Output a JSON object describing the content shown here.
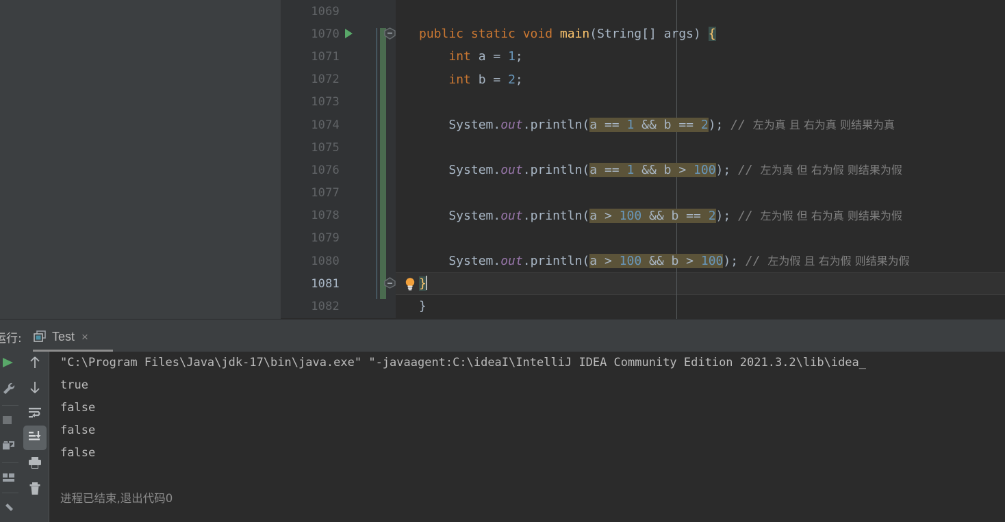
{
  "editor": {
    "lines": [
      {
        "number": "1069",
        "tokens": []
      },
      {
        "number": "1070",
        "indent": 1,
        "runnable": true,
        "fold_start": true,
        "tokens": [
          {
            "t": "public ",
            "c": "kw"
          },
          {
            "t": "static ",
            "c": "kw"
          },
          {
            "t": "void ",
            "c": "kw"
          },
          {
            "t": "main",
            "c": "mth"
          },
          {
            "t": "(",
            "c": "pl"
          },
          {
            "t": "String",
            "c": "cls"
          },
          {
            "t": "[] args) ",
            "c": "pl"
          },
          {
            "t": "{",
            "c": "brace-hl"
          }
        ]
      },
      {
        "number": "1071",
        "tokens": [
          {
            "t": "    ",
            "c": "pl"
          },
          {
            "t": "int ",
            "c": "kw"
          },
          {
            "t": "a = ",
            "c": "pl"
          },
          {
            "t": "1",
            "c": "num"
          },
          {
            "t": ";",
            "c": "pl"
          }
        ]
      },
      {
        "number": "1072",
        "tokens": [
          {
            "t": "    ",
            "c": "pl"
          },
          {
            "t": "int ",
            "c": "kw"
          },
          {
            "t": "b = ",
            "c": "pl"
          },
          {
            "t": "2",
            "c": "num"
          },
          {
            "t": ";",
            "c": "pl"
          }
        ]
      },
      {
        "number": "1073",
        "tokens": []
      },
      {
        "number": "1074",
        "tokens": [
          {
            "t": "    System.",
            "c": "pl"
          },
          {
            "t": "out",
            "c": "fld"
          },
          {
            "t": ".println(",
            "c": "pl"
          },
          {
            "t": "a == ",
            "c": "pl expr-hl"
          },
          {
            "t": "1",
            "c": "num expr-hl"
          },
          {
            "t": " && b == ",
            "c": "pl expr-hl"
          },
          {
            "t": "2",
            "c": "num expr-hl"
          },
          {
            "t": ");",
            "c": "pl"
          },
          {
            "t": " // ",
            "c": "cmt"
          },
          {
            "t": "左为真 且 右为真 则结果为真",
            "c": "cmt-cn"
          }
        ]
      },
      {
        "number": "1075",
        "tokens": []
      },
      {
        "number": "1076",
        "tokens": [
          {
            "t": "    System.",
            "c": "pl"
          },
          {
            "t": "out",
            "c": "fld"
          },
          {
            "t": ".println(",
            "c": "pl"
          },
          {
            "t": "a == ",
            "c": "pl expr-hl"
          },
          {
            "t": "1",
            "c": "num expr-hl"
          },
          {
            "t": " && b > ",
            "c": "pl expr-hl"
          },
          {
            "t": "100",
            "c": "num expr-hl"
          },
          {
            "t": ");",
            "c": "pl"
          },
          {
            "t": " // ",
            "c": "cmt"
          },
          {
            "t": "左为真 但 右为假 则结果为假",
            "c": "cmt-cn"
          }
        ]
      },
      {
        "number": "1077",
        "tokens": []
      },
      {
        "number": "1078",
        "tokens": [
          {
            "t": "    System.",
            "c": "pl"
          },
          {
            "t": "out",
            "c": "fld"
          },
          {
            "t": ".println(",
            "c": "pl"
          },
          {
            "t": "a > ",
            "c": "pl expr-hl"
          },
          {
            "t": "100",
            "c": "num expr-hl"
          },
          {
            "t": " && b == ",
            "c": "pl expr-hl"
          },
          {
            "t": "2",
            "c": "num expr-hl"
          },
          {
            "t": ");",
            "c": "pl"
          },
          {
            "t": " // ",
            "c": "cmt"
          },
          {
            "t": "左为假 但 右为真 则结果为假",
            "c": "cmt-cn"
          }
        ]
      },
      {
        "number": "1079",
        "tokens": []
      },
      {
        "number": "1080",
        "tokens": [
          {
            "t": "    System.",
            "c": "pl"
          },
          {
            "t": "out",
            "c": "fld"
          },
          {
            "t": ".println(",
            "c": "pl"
          },
          {
            "t": "a > ",
            "c": "pl expr-hl"
          },
          {
            "t": "100",
            "c": "num expr-hl"
          },
          {
            "t": " && b > ",
            "c": "pl expr-hl"
          },
          {
            "t": "100",
            "c": "num expr-hl"
          },
          {
            "t": ");",
            "c": "pl"
          },
          {
            "t": " // ",
            "c": "cmt"
          },
          {
            "t": "左为假 且 右为假 则结果为假",
            "c": "cmt-cn"
          }
        ]
      },
      {
        "number": "1081",
        "current": true,
        "fold_end": true,
        "bulb": true,
        "tokens": [
          {
            "t": "}",
            "c": "brace-hl"
          }
        ]
      },
      {
        "number": "1082",
        "tokens": [
          {
            "t": "}",
            "c": "pl"
          }
        ]
      }
    ],
    "colors": {
      "background": "#2b2b2b",
      "gutter": "#313335",
      "keyword": "#cc7832",
      "number": "#6897bb",
      "method": "#ffc66d",
      "field": "#9876aa",
      "plain": "#a9b7c6",
      "comment": "#808080",
      "expression_highlight": "#5b5339",
      "brace_highlight": "#3b514d",
      "vcs_changed": "#4a6b4f",
      "current_line": "#323232"
    }
  },
  "run_panel": {
    "label": "运行:",
    "tab": {
      "title": "Test",
      "close_label": "×",
      "icon": "run-configuration-icon"
    },
    "run_toolbar": [
      {
        "name": "rerun-button",
        "icon": "play-icon"
      },
      {
        "name": "edit-configuration",
        "icon": "wrench-icon"
      },
      {
        "name": "stop-button",
        "icon": "stop-square-icon"
      },
      {
        "name": "dump-threads-button",
        "icon": "camera-threads-icon"
      },
      {
        "name": "layout-settings",
        "icon": "layout-icon"
      },
      {
        "name": "pin-tab-button",
        "icon": "pin-icon"
      }
    ],
    "console_toolbar": [
      {
        "name": "prev-occurrence-button",
        "icon": "arrow-up-icon",
        "active": false
      },
      {
        "name": "next-occurrence-button",
        "icon": "arrow-down-icon",
        "active": false
      },
      {
        "name": "soft-wrap-button",
        "icon": "soft-wrap-icon",
        "active": false
      },
      {
        "name": "scroll-to-end-button",
        "icon": "scroll-to-end-icon",
        "active": true
      },
      {
        "name": "print-button",
        "icon": "printer-icon",
        "active": false
      },
      {
        "name": "clear-all-button",
        "icon": "trash-icon",
        "active": false
      }
    ],
    "console": {
      "lines": [
        {
          "text": "\"C:\\Program Files\\Java\\jdk-17\\bin\\java.exe\" \"-javaagent:C:\\ideaI\\IntelliJ IDEA Community Edition 2021.3.2\\lib\\idea_",
          "cn": false
        },
        {
          "text": "true",
          "cn": false
        },
        {
          "text": "false",
          "cn": false
        },
        {
          "text": "false",
          "cn": false
        },
        {
          "text": "false",
          "cn": false
        },
        {
          "text": "",
          "cn": false
        },
        {
          "text": "进程已结束,退出代码0",
          "cn": true
        }
      ]
    }
  }
}
